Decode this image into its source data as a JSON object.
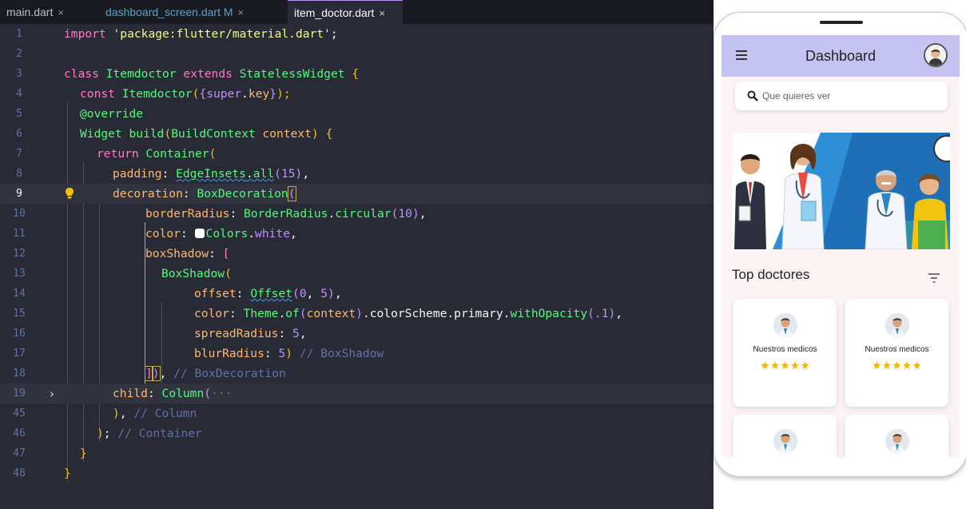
{
  "tabs": [
    {
      "label": "main.dart",
      "close": "×"
    },
    {
      "label": "dashboard_screen.dart M",
      "close": "×"
    },
    {
      "label": "item_doctor.dart",
      "close": "×"
    }
  ],
  "line_numbers": [
    "1",
    "2",
    "3",
    "4",
    "5",
    "6",
    "7",
    "8",
    "9",
    "10",
    "11",
    "12",
    "13",
    "14",
    "15",
    "16",
    "17",
    "18",
    "19",
    "45",
    "46",
    "47",
    "48"
  ],
  "code": {
    "l1": {
      "kw": "import",
      "str": "'package:flutter/material.dart'",
      "end": ";"
    },
    "l3": {
      "kw1": "class",
      "name": "Itemdoctor",
      "kw2": "extends",
      "base": "StatelessWidget",
      "brace": "{"
    },
    "l4": {
      "kw": "const",
      "name": "Itemdoctor",
      "p1": "(",
      "p2": "{",
      "sup": "super",
      "dot": ".",
      "key": "key",
      "p3": "}",
      "p4": ");"
    },
    "l5": {
      "ann": "@override"
    },
    "l6": {
      "type": "Widget",
      "fn": "build",
      "p1": "(",
      "ctype": "BuildContext",
      "arg": "context",
      "p2": ")",
      "brace": "{"
    },
    "l7": {
      "kw": "return",
      "fn": "Container",
      "p": "("
    },
    "l8": {
      "prop": "padding",
      "colon": ":",
      "cls": "EdgeInsets",
      "dot": ".",
      "fn": "all",
      "p1": "(",
      "num": "15",
      "p2": ")",
      "end": ","
    },
    "l9": {
      "prop": "decoration",
      "colon": ":",
      "cls": "BoxDecoration",
      "p": "("
    },
    "l10": {
      "prop": "borderRadius",
      "colon": ":",
      "cls": "BorderRadius",
      "dot": ".",
      "fn": "circular",
      "p1": "(",
      "num": "10",
      "p2": ")",
      "end": ","
    },
    "l11": {
      "prop": "color",
      "colon": ":",
      "cls": "Colors",
      "dot": ".",
      "val": "white",
      "end": ","
    },
    "l12": {
      "prop": "boxShadow",
      "colon": ":",
      "br": "["
    },
    "l13": {
      "cls": "BoxShadow",
      "p": "("
    },
    "l14": {
      "prop": "offset",
      "colon": ":",
      "cls": "Offset",
      "p1": "(",
      "n1": "0",
      "comma": ",",
      "n2": "5",
      "p2": ")",
      "end": ","
    },
    "l15": {
      "prop": "color",
      "colon": ":",
      "cls": "Theme",
      "d1": ".",
      "of": "of",
      "p1": "(",
      "ctx": "context",
      "p2": ")",
      "chain": ".colorScheme.primary.",
      "fn": "withOpacity",
      "p3": "(",
      "num": ".1",
      "p4": ")",
      "end": ","
    },
    "l16": {
      "prop": "spreadRadius",
      "colon": ":",
      "num": "5",
      "end": ","
    },
    "l17": {
      "prop": "blurRadius",
      "colon": ":",
      "num": "5",
      "p": ")",
      "comment": "// BoxShadow"
    },
    "l18": {
      "brk": "]",
      "p": ")",
      "end": ",",
      "comment": "// BoxDecoration"
    },
    "l19": {
      "prop": "child",
      "colon": ":",
      "cls": "Column",
      "p": "(",
      "ell": "···"
    },
    "l45": {
      "p": ")",
      "end": ",",
      "comment": "// Column"
    },
    "l46": {
      "p": ")",
      "end": ";",
      "comment": "// Container"
    },
    "l47": {
      "brace": "}"
    },
    "l48": {
      "brace": "}"
    }
  },
  "phone": {
    "appbar_title": "Dashboard",
    "search_placeholder": "Que quieres ver",
    "section_title": "Top doctores",
    "cards": [
      {
        "label": "Nuestros medicos",
        "stars": "★★★★★"
      },
      {
        "label": "Nuestros medicos",
        "stars": "★★★★★"
      }
    ],
    "colors": {
      "appbar": "#c5c3f2",
      "star": "#f4b400",
      "screen_bg": "#fcf3f5"
    }
  }
}
